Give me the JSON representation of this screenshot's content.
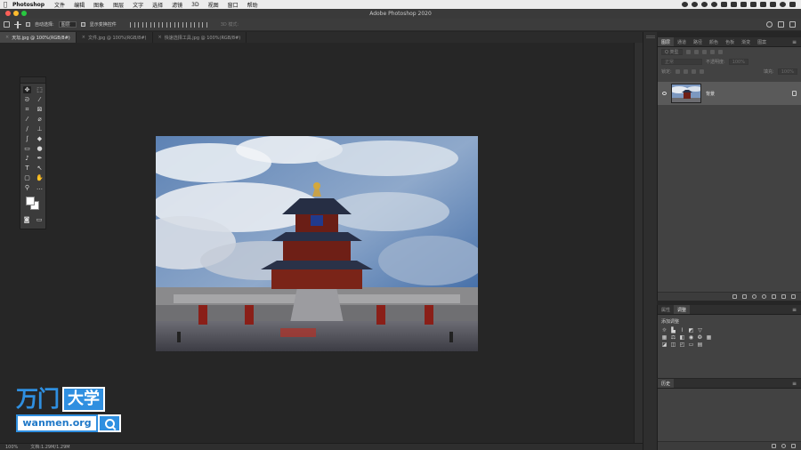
{
  "menubar": {
    "app_name": "Photoshop",
    "items": [
      "文件",
      "编辑",
      "图象",
      "图层",
      "文字",
      "选择",
      "滤镜",
      "3D",
      "视图",
      "窗口",
      "帮助"
    ]
  },
  "window": {
    "title": "Adobe Photoshop 2020"
  },
  "options_bar": {
    "auto_select_label": "自动选择:",
    "auto_select_value": "图层",
    "show_transform_label": "显示变换控件",
    "mode_3d_label": "3D 模式:"
  },
  "tabs": [
    {
      "label": "天坛.jpg @ 100%(RGB/8#)",
      "active": true
    },
    {
      "label": "文件.jpg @ 100%(RGB/8#)",
      "active": false
    },
    {
      "label": "快速选择工具.jpg @ 100%(RGB/8#)",
      "active": false
    }
  ],
  "status_bar": {
    "zoom": "100%",
    "doc_info": "文档:1.29M/1.29M"
  },
  "layers_panel": {
    "tabs": [
      "图层",
      "通道",
      "路径",
      "颜色",
      "色板",
      "渐变",
      "图案"
    ],
    "active_tab": "图层",
    "filter_placeholder": "Q 类型",
    "blend_mode": "正常",
    "opacity_label": "不透明度:",
    "opacity_value": "100%",
    "lock_label": "锁定:",
    "fill_label": "填充:",
    "fill_value": "100%",
    "layer_name": "背景"
  },
  "adjust_panel": {
    "tabs": [
      "属性",
      "调整"
    ],
    "active_tab": "调整",
    "add_label": "添加调整"
  },
  "history_panel": {
    "tab": "历史"
  },
  "watermark": {
    "cn": "万门",
    "box": "大学",
    "url": "wanmen.org"
  },
  "colors": {
    "accent": "#2f8fe0",
    "panel": "#424242",
    "canvas": "#262626"
  }
}
